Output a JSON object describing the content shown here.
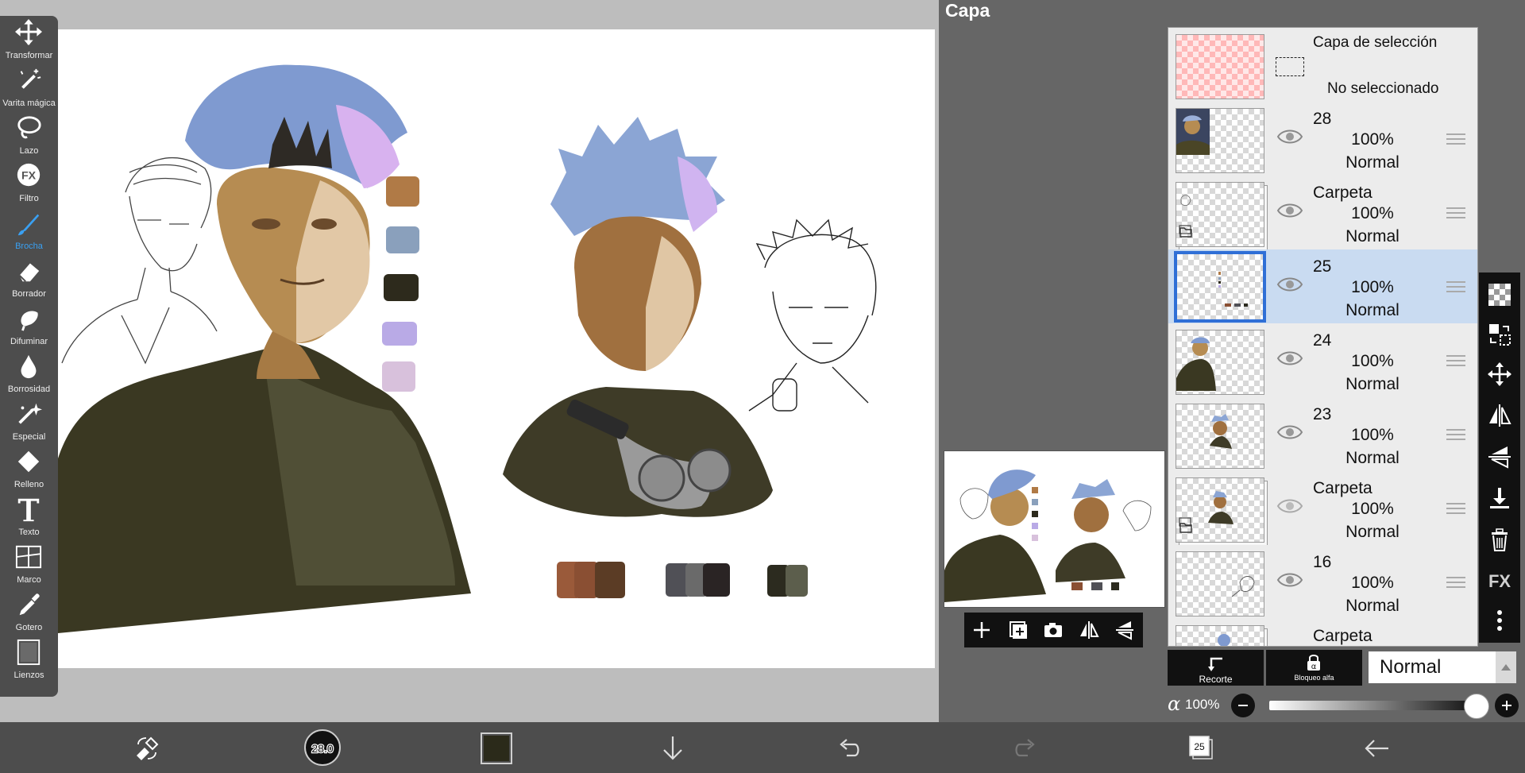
{
  "tools": [
    {
      "label": "Transformar",
      "icon": "transform-icon"
    },
    {
      "label": "Varita mágica",
      "icon": "magic-wand-icon"
    },
    {
      "label": "Lazo",
      "icon": "lasso-icon"
    },
    {
      "label": "Filtro",
      "icon": "fx-filter-icon"
    },
    {
      "label": "Brocha",
      "icon": "brush-icon",
      "active": true
    },
    {
      "label": "Borrador",
      "icon": "eraser-icon"
    },
    {
      "label": "Difuminar",
      "icon": "smudge-icon"
    },
    {
      "label": "Borrosidad",
      "icon": "blur-drop-icon"
    },
    {
      "label": "Especial",
      "icon": "special-brush-icon"
    },
    {
      "label": "Relleno",
      "icon": "fill-bucket-icon"
    },
    {
      "label": "Texto",
      "icon": "text-icon"
    },
    {
      "label": "Marco",
      "icon": "frame-divider-icon"
    },
    {
      "label": "Gotero",
      "icon": "eyedropper-icon"
    },
    {
      "label": "Lienzos",
      "icon": "canvas-icon"
    }
  ],
  "panel": {
    "title": "Capa"
  },
  "selection_layer": {
    "name": "Capa de selección",
    "status": "No seleccionado"
  },
  "layers": [
    {
      "name": "28",
      "opacity": "100%",
      "mode": "Normal",
      "type": "layer"
    },
    {
      "name": "Carpeta",
      "opacity": "100%",
      "mode": "Normal",
      "type": "folder"
    },
    {
      "name": "25",
      "opacity": "100%",
      "mode": "Normal",
      "type": "layer",
      "selected": true
    },
    {
      "name": "24",
      "opacity": "100%",
      "mode": "Normal",
      "type": "layer"
    },
    {
      "name": "23",
      "opacity": "100%",
      "mode": "Normal",
      "type": "layer"
    },
    {
      "name": "Carpeta",
      "opacity": "100%",
      "mode": "Normal",
      "type": "folder"
    },
    {
      "name": "16",
      "opacity": "100%",
      "mode": "Normal",
      "type": "layer"
    },
    {
      "name": "Carpeta",
      "opacity": "",
      "mode": "",
      "type": "folder"
    }
  ],
  "blend": {
    "recorte_label": "Recorte",
    "alpha_lock_label": "Bloqueo alfa",
    "mode": "Normal"
  },
  "opacity": {
    "symbol": "α",
    "value": "100%",
    "fraction": 1.0
  },
  "bottom": {
    "brush_size": "28.0",
    "layer_count": "25"
  },
  "colors": {
    "current": "#2b2a1a",
    "palette": [
      "#b07a46",
      "#8aa0bc",
      "#2d2a1c",
      "#b9aae6",
      "#d8c1dc"
    ],
    "accent": "#3aa0f2",
    "selected_layer_bg": "#c9dbf1"
  }
}
